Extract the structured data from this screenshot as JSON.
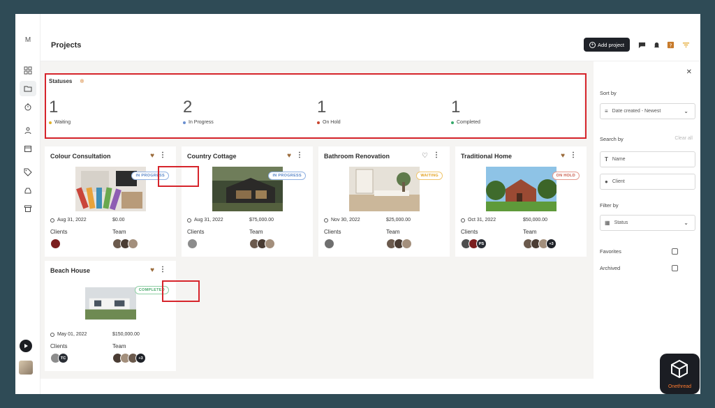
{
  "app": {
    "logo_letter": "M"
  },
  "header": {
    "title": "Projects",
    "add_button": "Add project"
  },
  "statuses": {
    "title": "Statuses",
    "items": [
      {
        "count": "1",
        "label": "Waiting",
        "color": "#e0b12b"
      },
      {
        "count": "2",
        "label": "In Progress",
        "color": "#6a8fd0"
      },
      {
        "count": "1",
        "label": "On Hold",
        "color": "#c9452f"
      },
      {
        "count": "1",
        "label": "Completed",
        "color": "#35a86a"
      }
    ]
  },
  "projects": [
    {
      "title": "Colour Consultation",
      "status": "IN PROGRESS",
      "date": "Aug 31, 2022",
      "amount": "$0.00",
      "clients_label": "Clients",
      "team_label": "Team",
      "favorite": true
    },
    {
      "title": "Country Cottage",
      "status": "IN PROGRESS",
      "date": "Aug 31, 2022",
      "amount": "$75,000.00",
      "clients_label": "Clients",
      "team_label": "Team",
      "favorite": true
    },
    {
      "title": "Bathroom Renovation",
      "status": "WAITING",
      "date": "Nov 30, 2022",
      "amount": "$25,000.00",
      "clients_label": "Clients",
      "team_label": "Team",
      "favorite": false
    },
    {
      "title": "Traditional Home",
      "status": "ON HOLD",
      "date": "Oct 31, 2022",
      "amount": "$50,000.00",
      "clients_label": "Clients",
      "team_label": "Team",
      "favorite": true,
      "client_initials": "PS",
      "team_more": "+3"
    },
    {
      "title": "Beach House",
      "status": "COMPLETED",
      "date": "May 01, 2022",
      "amount": "$150,000.00",
      "clients_label": "Clients",
      "team_label": "Team",
      "favorite": true,
      "client_initials": "TC",
      "team_more": "+3"
    }
  ],
  "filters": {
    "sort_by_label": "Sort by",
    "sort_value": "Date created - Newest",
    "search_by_label": "Search by",
    "clear_all": "Clear all",
    "name_placeholder": "Name",
    "client_placeholder": "Client",
    "filter_by_label": "Filter by",
    "status_value": "Status",
    "favorites_label": "Favorites",
    "archived_label": "Archived"
  },
  "watermark": {
    "text": "Onethread"
  }
}
